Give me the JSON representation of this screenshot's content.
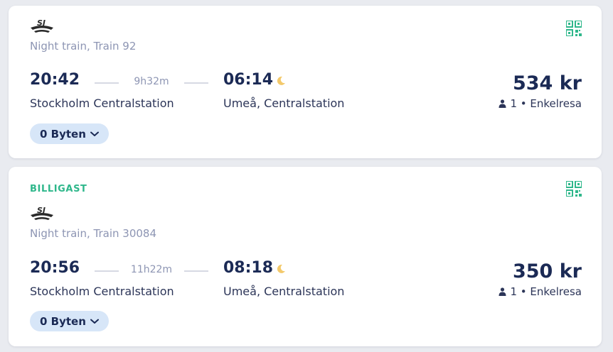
{
  "trips": [
    {
      "badge": "",
      "operator_logo": "sj-logo",
      "train_name": "Night train, Train 92",
      "departure_time": "20:42",
      "duration": "9h32m",
      "arrival_time": "06:14",
      "arrival_icon": "moon-icon",
      "departure_station": "Stockholm Centralstation",
      "arrival_station": "Umeå, Centralstation",
      "price": "534 kr",
      "passengers": "1 • Enkelresa",
      "changes_label": "0 Byten"
    },
    {
      "badge": "BILLIGAST",
      "operator_logo": "sj-logo",
      "train_name": "Night train, Train 30084",
      "departure_time": "20:56",
      "duration": "11h22m",
      "arrival_time": "08:18",
      "arrival_icon": "moon-icon",
      "departure_station": "Stockholm Centralstation",
      "arrival_station": "Umeå, Centralstation",
      "price": "350 kr",
      "passengers": "1 • Enkelresa",
      "changes_label": "0 Byten"
    }
  ],
  "colors": {
    "accent_green": "#2fb78b",
    "text_dark": "#1b2a55",
    "text_muted": "#8d95b3",
    "button_bg": "#d7e6f8",
    "moon": "#f3c96b"
  }
}
